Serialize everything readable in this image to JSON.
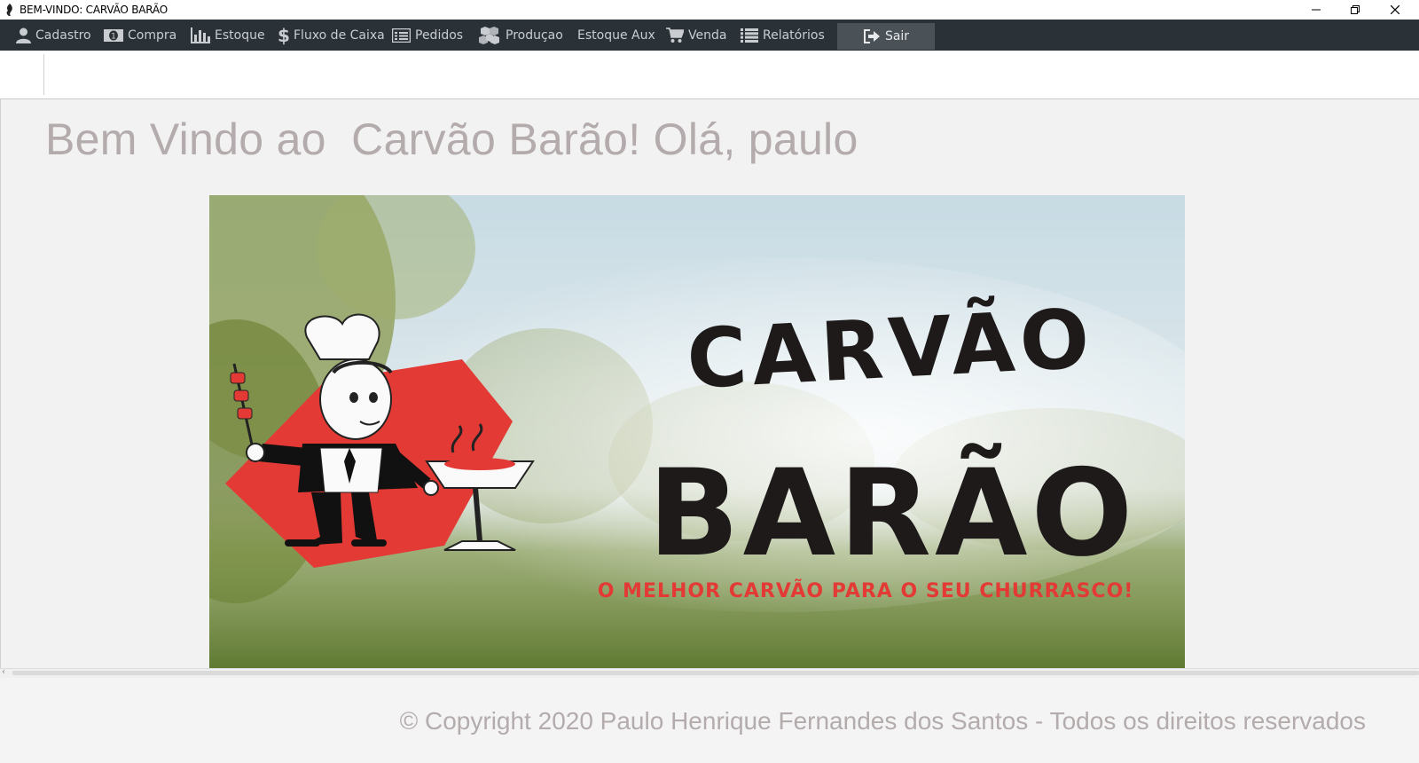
{
  "window": {
    "title": "BEM-VINDO: CARVÃO BARÃO"
  },
  "menu": {
    "items": [
      {
        "label": "Cadastro",
        "icon": "user-icon"
      },
      {
        "label": "Compra",
        "icon": "money-icon"
      },
      {
        "label": "Estoque",
        "icon": "bar-chart-icon"
      },
      {
        "label": "Fluxo de Caixa",
        "icon": "dollar-icon"
      },
      {
        "label": "Pedidos",
        "icon": "list-box-icon"
      },
      {
        "label": "Produçao",
        "icon": "cubes-icon"
      },
      {
        "label": "Estoque Aux",
        "icon": ""
      },
      {
        "label": "Venda",
        "icon": "cart-icon"
      },
      {
        "label": "Relatórios",
        "icon": "list-icon"
      }
    ],
    "logout_label": "Sair"
  },
  "welcome_text": "Bem Vindo ao  Carvão Barão! Olá, paulo",
  "banner": {
    "brand_line1": "CARVÃO",
    "brand_line2": "BARÃO",
    "slogan": "O MELHOR CARVÃO PARA O SEU CHURRASCO!"
  },
  "footer": {
    "copyright": "© Copyright 2020 Paulo Henrique Fernandes dos Santos - Todos os direitos reservados"
  },
  "colors": {
    "menubar_bg": "#2a3238",
    "menu_text": "#c9cdd1",
    "welcome_text": "#b4acac",
    "banner_red": "#e33a35"
  }
}
